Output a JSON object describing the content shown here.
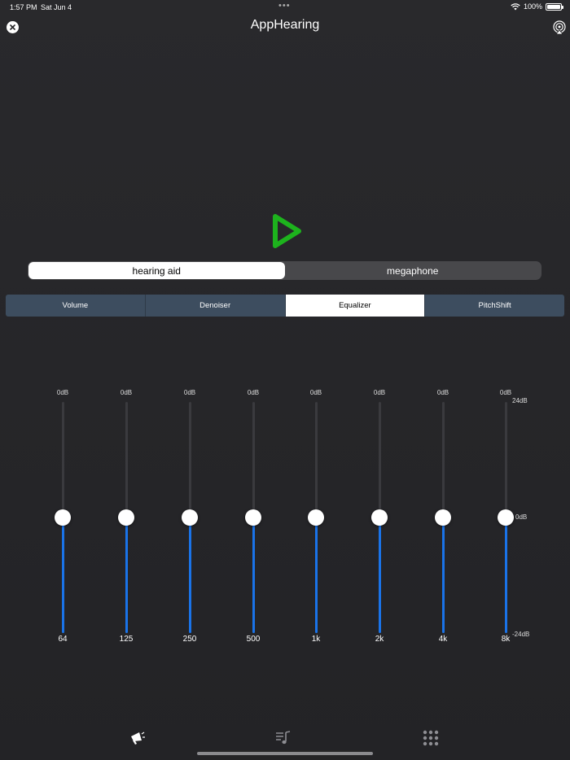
{
  "status_bar": {
    "time": "1:57 PM",
    "date": "Sat Jun 4",
    "battery": "100%",
    "dots": "•••"
  },
  "header": {
    "title": "AppHearing",
    "close_icon": "close-icon",
    "airplay_icon": "airplay-icon"
  },
  "play": {
    "icon": "play-icon",
    "color": "#1db31d"
  },
  "mode": {
    "options": [
      "hearing aid",
      "megaphone"
    ],
    "selected": "hearing aid"
  },
  "tabs": {
    "items": [
      "Volume",
      "Denoiser",
      "Equalizer",
      "PitchShift"
    ],
    "selected": "Equalizer"
  },
  "equalizer": {
    "scale_max": "24dB",
    "scale_mid": "0dB",
    "scale_min": "-24dB",
    "range_db": [
      -24,
      24
    ],
    "accent": "#1a73e8",
    "bands": [
      {
        "label": "64",
        "value_text": "0dB",
        "gain_db": 0
      },
      {
        "label": "125",
        "value_text": "0dB",
        "gain_db": 0
      },
      {
        "label": "250",
        "value_text": "0dB",
        "gain_db": 0
      },
      {
        "label": "500",
        "value_text": "0dB",
        "gain_db": 0
      },
      {
        "label": "1k",
        "value_text": "0dB",
        "gain_db": 0
      },
      {
        "label": "2k",
        "value_text": "0dB",
        "gain_db": 0
      },
      {
        "label": "4k",
        "value_text": "0dB",
        "gain_db": 0
      },
      {
        "label": "8k",
        "value_text": "0dB",
        "gain_db": 0
      }
    ]
  },
  "bottom_bar": {
    "icons": [
      "megaphone-icon",
      "playlist-music-icon",
      "apps-grid-icon"
    ]
  }
}
